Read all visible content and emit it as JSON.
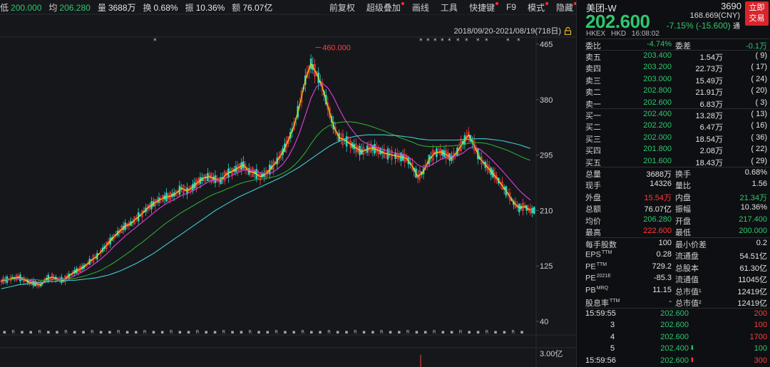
{
  "top_stats": [
    {
      "label": "低",
      "value": "200.000",
      "color": "green"
    },
    {
      "label": "均",
      "value": "206.280",
      "color": "green"
    },
    {
      "label": "量",
      "value": "3688万",
      "color": "white"
    },
    {
      "label": "换",
      "value": "0.68%",
      "color": "white"
    },
    {
      "label": "振",
      "value": "10.36%",
      "color": "white"
    },
    {
      "label": "额",
      "value": "76.07亿",
      "color": "white"
    }
  ],
  "toolbar": [
    {
      "label": "前复权",
      "dot": false
    },
    {
      "label": "超级叠加",
      "dot": true
    },
    {
      "label": "画线",
      "dot": false
    },
    {
      "label": "工具",
      "dot": false
    },
    {
      "label": "快捷键",
      "dot": true
    },
    {
      "label": "F9",
      "dot": false
    },
    {
      "label": "模式",
      "dot": true
    },
    {
      "label": "隐藏",
      "dot": true
    }
  ],
  "date_range": "2018/09/20-2021/08/19(718日)",
  "peak_label": "460.000",
  "volume_axis_label": "3.00亿",
  "y_axis_ticks": [
    "465",
    "380",
    "295",
    "210",
    "125",
    "40"
  ],
  "chart_data": {
    "type": "line",
    "title": "",
    "xlabel": "",
    "ylabel": "",
    "x_range": [
      "2018/09/20",
      "2021/08/19"
    ],
    "ylim": [
      40,
      465
    ],
    "y_ticks": [
      465,
      380,
      295,
      210,
      125,
      40
    ],
    "peak": {
      "value": 460.0
    },
    "series": [
      {
        "color": "#ffd400",
        "values": [
          102,
          104,
          106,
          108,
          104,
          100,
          98,
          96,
          105,
          108,
          105,
          103,
          110,
          116,
          120,
          126,
          134,
          140,
          150,
          160,
          170,
          178,
          186,
          190,
          198,
          205,
          214,
          220,
          226,
          230,
          232,
          236,
          244,
          240,
          246,
          254,
          260,
          262,
          258,
          256,
          266,
          270,
          275,
          280,
          270,
          268,
          262,
          266,
          276,
          286,
          300,
          318,
          340,
          372,
          410,
          435,
          420,
          400,
          370,
          340,
          322,
          318,
          312,
          306,
          300,
          304,
          306,
          302,
          298,
          296,
          294,
          292,
          290,
          278,
          262,
          270,
          288,
          298,
          300,
          296,
          290,
          300,
          314,
          326,
          310,
          290,
          280,
          270,
          260,
          248,
          236,
          222,
          214,
          216,
          210
        ]
      },
      {
        "color": "#e040e0",
        "values": [
          103,
          104,
          105,
          106,
          105,
          103,
          101,
          99,
          101,
          104,
          105,
          104,
          106,
          110,
          114,
          119,
          125,
          131,
          138,
          146,
          155,
          163,
          171,
          178,
          185,
          192,
          199,
          206,
          213,
          219,
          224,
          228,
          233,
          236,
          240,
          245,
          250,
          255,
          257,
          257,
          260,
          264,
          268,
          272,
          272,
          271,
          268,
          266,
          268,
          273,
          281,
          293,
          309,
          330,
          356,
          382,
          400,
          405,
          398,
          384,
          366,
          350,
          337,
          326,
          317,
          312,
          309,
          306,
          303,
          300,
          298,
          296,
          294,
          288,
          280,
          276,
          278,
          283,
          288,
          292,
          292,
          294,
          298,
          305,
          308,
          304,
          297,
          289,
          280,
          271,
          261,
          251,
          241,
          233,
          226
        ]
      },
      {
        "color": "#2fa830",
        "values": [
          104,
          104,
          105,
          105,
          105,
          104,
          104,
          103,
          103,
          104,
          104,
          104,
          105,
          106,
          108,
          110,
          113,
          116,
          120,
          125,
          130,
          136,
          142,
          148,
          155,
          161,
          168,
          175,
          182,
          189,
          195,
          201,
          207,
          212,
          217,
          222,
          227,
          232,
          236,
          239,
          243,
          246,
          250,
          253,
          255,
          257,
          258,
          259,
          261,
          263,
          267,
          272,
          279,
          288,
          299,
          312,
          324,
          333,
          339,
          343,
          345,
          346,
          346,
          345,
          343,
          341,
          338,
          335,
          332,
          328,
          325,
          321,
          318,
          315,
          311,
          309,
          308,
          308,
          308,
          309,
          309,
          310,
          311,
          313,
          314,
          314,
          313,
          311,
          308,
          305,
          302,
          298,
          294,
          290,
          287
        ]
      },
      {
        "color": "#3fcfd0",
        "values": [
          90,
          92,
          94,
          96,
          97,
          98,
          99,
          100,
          101,
          101,
          102,
          102,
          103,
          103,
          104,
          105,
          106,
          107,
          109,
          111,
          114,
          117,
          121,
          125,
          129,
          134,
          139,
          144,
          150,
          156,
          162,
          168,
          174,
          180,
          186,
          192,
          198,
          204,
          210,
          215,
          220,
          225,
          230,
          234,
          238,
          242,
          246,
          250,
          254,
          258,
          262,
          267,
          272,
          277,
          283,
          289,
          295,
          301,
          307,
          312,
          316,
          320,
          322,
          324,
          325,
          326,
          326,
          326,
          326,
          325,
          325,
          324,
          323,
          322,
          320,
          319,
          318,
          318,
          318,
          318,
          318,
          318,
          319,
          319,
          320,
          320,
          320,
          319,
          318,
          317,
          315,
          313,
          311,
          308,
          305
        ]
      }
    ]
  },
  "panel": {
    "name": "美团-W",
    "code": "3690",
    "trade_button": [
      "立即",
      "交易"
    ],
    "price": "202.600",
    "cny": "168.669(CNY)",
    "change": "-7.15% (-15.600)",
    "change_suffix": "通",
    "meta": [
      "HKEX",
      "HKD",
      "16:08:02"
    ],
    "weibi": {
      "label": "委比",
      "value": "-4.74%",
      "label2": "委差",
      "value2": "-0.1万"
    },
    "asks": [
      {
        "label": "卖五",
        "price": "203.400",
        "vol": "1.54万",
        "cnt": "9"
      },
      {
        "label": "卖四",
        "price": "203.200",
        "vol": "22.73万",
        "cnt": "17"
      },
      {
        "label": "卖三",
        "price": "203.000",
        "vol": "15.49万",
        "cnt": "24"
      },
      {
        "label": "卖二",
        "price": "202.800",
        "vol": "21.91万",
        "cnt": "20"
      },
      {
        "label": "卖一",
        "price": "202.600",
        "vol": "6.83万",
        "cnt": "3"
      }
    ],
    "bids": [
      {
        "label": "买一",
        "price": "202.400",
        "vol": "13.28万",
        "cnt": "13"
      },
      {
        "label": "买二",
        "price": "202.200",
        "vol": "6.47万",
        "cnt": "16"
      },
      {
        "label": "买三",
        "price": "202.000",
        "vol": "18.54万",
        "cnt": "36"
      },
      {
        "label": "买四",
        "price": "201.800",
        "vol": "2.08万",
        "cnt": "22"
      },
      {
        "label": "买五",
        "price": "201.600",
        "vol": "18.43万",
        "cnt": "29"
      }
    ],
    "stats": [
      {
        "l1": "总量",
        "v1": "3688万",
        "c1": "white",
        "l2": "换手",
        "v2": "0.68%",
        "c2": "white"
      },
      {
        "l1": "现手",
        "v1": "14326",
        "c1": "white",
        "l2": "量比",
        "v2": "1.56",
        "c2": "white"
      },
      {
        "l1": "外盘",
        "v1": "15.54万",
        "c1": "red",
        "l2": "内盘",
        "v2": "21.34万",
        "c2": "green"
      },
      {
        "l1": "总额",
        "v1": "76.07亿",
        "c1": "white",
        "l2": "振幅",
        "v2": "10.36%",
        "c2": "white"
      },
      {
        "l1": "均价",
        "v1": "206.280",
        "c1": "green",
        "l2": "开盘",
        "v2": "217.400",
        "c2": "green"
      },
      {
        "l1": "最高",
        "v1": "222.600",
        "c1": "red",
        "l2": "最低",
        "v2": "200.000",
        "c2": "green"
      }
    ],
    "fundamentals": [
      {
        "l1": "每手股数",
        "v1": "100",
        "l2": "最小价差",
        "v2": "0.2"
      },
      {
        "l1": "EPS",
        "s1": "TTM",
        "v1": "0.28",
        "l2": "流通盘",
        "v2": "54.51亿"
      },
      {
        "l1": "PE",
        "s1": "TTM",
        "v1": "729.2",
        "l2": "总股本",
        "v2": "61.30亿"
      },
      {
        "l1": "PE",
        "s1": "2021E",
        "v1": "-85.3",
        "l2": "流通值",
        "v2": "11045亿"
      },
      {
        "l1": "PB",
        "s1": "MRQ",
        "v1": "11.15",
        "l2": "总市值¹",
        "v2": "12419亿"
      },
      {
        "l1": "股息率",
        "s1": "TTM",
        "v1": "-",
        "l2": "总市值²",
        "v2": "12419亿"
      }
    ],
    "ticks": [
      {
        "time": "15:59:55",
        "price": "202.600",
        "arrow": "",
        "vol": "200",
        "vcolor": "red"
      },
      {
        "time": "3",
        "price": "202.600",
        "arrow": "",
        "vol": "100",
        "vcolor": "red"
      },
      {
        "time": "4",
        "price": "202.600",
        "arrow": "",
        "vol": "1700",
        "vcolor": "red"
      },
      {
        "time": "5",
        "price": "202.400",
        "arrow": "down",
        "vol": "100",
        "vcolor": "green"
      },
      {
        "time": "15:59:56",
        "price": "202.600",
        "arrow": "up",
        "vol": "300",
        "vcolor": "red"
      }
    ]
  }
}
